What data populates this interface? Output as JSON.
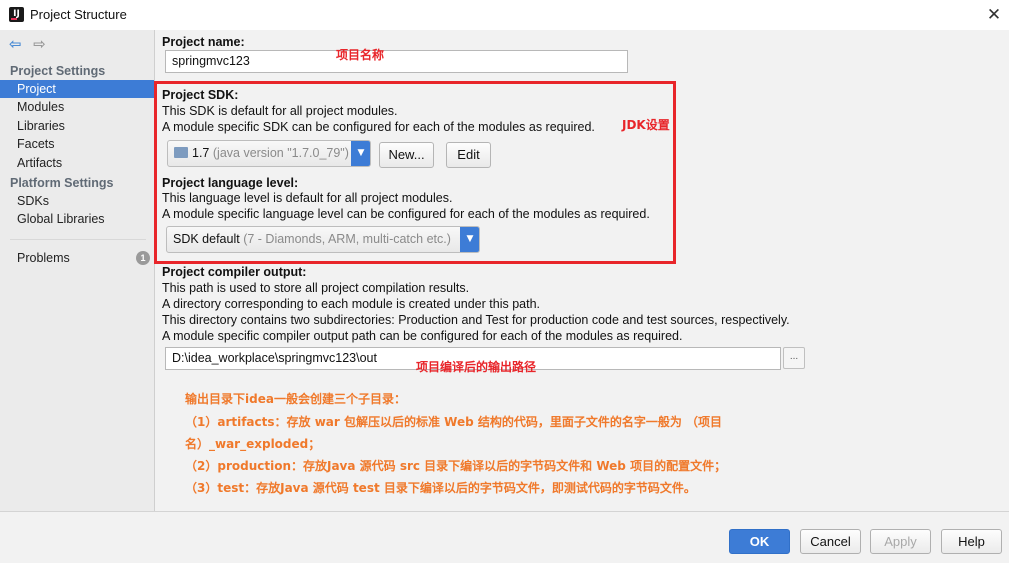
{
  "window": {
    "title": "Project Structure",
    "app_icon_label": "IJ"
  },
  "sidebar": {
    "sections": [
      {
        "heading": "Project Settings",
        "items": [
          "Project",
          "Modules",
          "Libraries",
          "Facets",
          "Artifacts"
        ]
      },
      {
        "heading": "Platform Settings",
        "items": [
          "SDKs",
          "Global Libraries"
        ]
      }
    ],
    "selected_item": "Project",
    "problems": {
      "label": "Problems",
      "count": "1"
    }
  },
  "project_name": {
    "label": "Project name:",
    "value": "springmvc123",
    "annotation": "项目名称"
  },
  "project_sdk": {
    "label": "Project SDK:",
    "desc_line1": "This SDK is default for all project modules.",
    "desc_line2": "A module specific SDK can be configured for each of the modules as required.",
    "selected": "1.7",
    "selected_detail": "(java version \"1.7.0_79\")",
    "new_button": "New...",
    "edit_button": "Edit",
    "annotation": "JDK设置"
  },
  "language_level": {
    "label": "Project language level:",
    "desc_line1": "This language level is default for all project modules.",
    "desc_line2": "A module specific language level can be configured for each of the modules as required.",
    "selected": "SDK default",
    "selected_detail": "(7 - Diamonds, ARM, multi-catch etc.)"
  },
  "compiler_output": {
    "label": "Project compiler output:",
    "desc_lines": [
      "This path is used to store all project compilation results.",
      "A directory corresponding to each module is created under this path.",
      "This directory contains two subdirectories: Production and Test for production code and test sources, respectively.",
      "A module specific compiler output path can be configured for each of the modules as required."
    ],
    "value": "D:\\idea_workplace\\springmvc123\\out",
    "browse_label": "...",
    "annotation": "项目编译后的输出路径"
  },
  "notes": [
    "输出目录下idea一般会创建三个子目录：",
    "（1）artifacts：存放 war 包解压以后的标准 Web 结构的代码，里面子文件的名字一般为 （项目",
    "名）_war_exploded；",
    "（2）production：存放Java 源代码 src 目录下编译以后的字节码文件和 Web 项目的配置文件；",
    "（3）test：存放Java 源代码 test 目录下编译以后的字节码文件，即测试代码的字节码文件。"
  ],
  "footer": {
    "ok": "OK",
    "cancel": "Cancel",
    "apply": "Apply",
    "help": "Help"
  },
  "colors": {
    "accent": "#3d7cd6",
    "annotation_red": "#e8252a",
    "note_orange": "#f0792b"
  }
}
